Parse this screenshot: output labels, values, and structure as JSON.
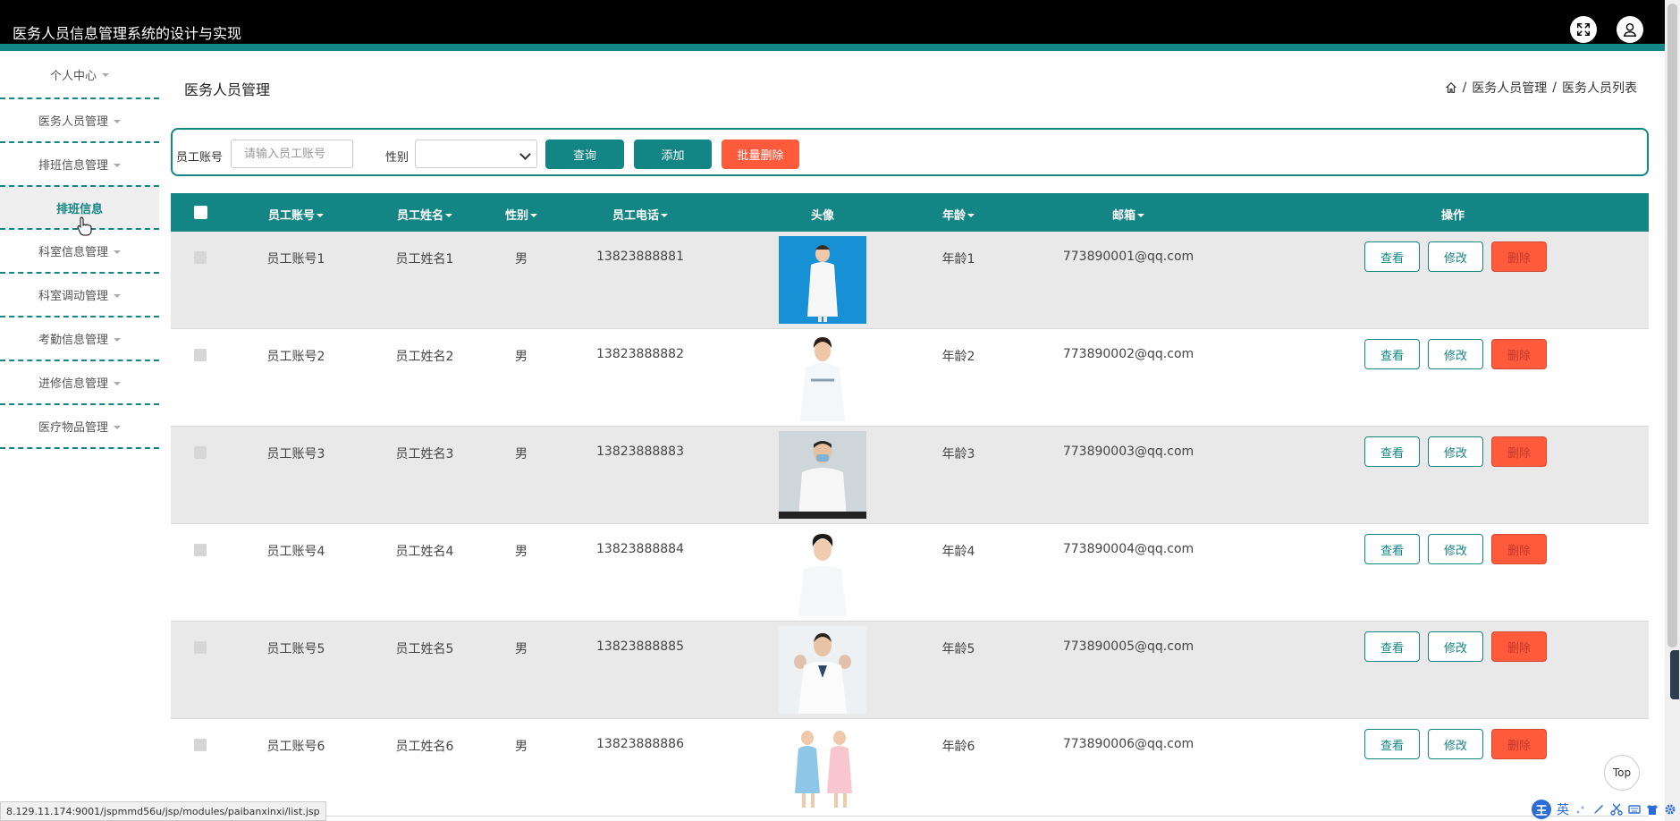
{
  "app": {
    "title": "医务人员信息管理系统的设计与实现"
  },
  "header_icons": [
    "fullscreen-icon",
    "user-icon"
  ],
  "sidebar": {
    "items": [
      {
        "label": "个人中心",
        "has_caret": true
      },
      {
        "label": "医务人员管理",
        "has_caret": true
      },
      {
        "label": "排班信息管理",
        "has_caret": true
      },
      {
        "label": "排班信息",
        "has_caret": false,
        "active": true
      },
      {
        "label": "科室信息管理",
        "has_caret": true
      },
      {
        "label": "科室调动管理",
        "has_caret": true
      },
      {
        "label": "考勤信息管理",
        "has_caret": true
      },
      {
        "label": "进修信息管理",
        "has_caret": true
      },
      {
        "label": "医疗物品管理",
        "has_caret": true
      }
    ]
  },
  "page": {
    "title": "医务人员管理",
    "breadcrumb": {
      "sep": "/",
      "level1": "医务人员管理",
      "level2": "医务人员列表"
    }
  },
  "search": {
    "account_label": "员工账号",
    "account_placeholder": "请输入员工账号",
    "gender_label": "性别",
    "gender_value": "",
    "query_button": "查询",
    "add_button": "添加",
    "batch_delete_button": "批量删除"
  },
  "table": {
    "columns": [
      "员工账号",
      "员工姓名",
      "性别",
      "员工电话",
      "头像",
      "年龄",
      "邮箱",
      "操作"
    ],
    "action_labels": {
      "view": "查看",
      "edit": "修改",
      "delete": "删除"
    },
    "rows": [
      {
        "account": "员工账号1",
        "name": "员工姓名1",
        "gender": "男",
        "phone": "13823888881",
        "age": "年龄1",
        "email": "773890001@qq.com"
      },
      {
        "account": "员工账号2",
        "name": "员工姓名2",
        "gender": "男",
        "phone": "13823888882",
        "age": "年龄2",
        "email": "773890002@qq.com"
      },
      {
        "account": "员工账号3",
        "name": "员工姓名3",
        "gender": "男",
        "phone": "13823888883",
        "age": "年龄3",
        "email": "773890003@qq.com"
      },
      {
        "account": "员工账号4",
        "name": "员工姓名4",
        "gender": "男",
        "phone": "13823888884",
        "age": "年龄4",
        "email": "773890004@qq.com"
      },
      {
        "account": "员工账号5",
        "name": "员工姓名5",
        "gender": "男",
        "phone": "13823888885",
        "age": "年龄5",
        "email": "773890005@qq.com"
      },
      {
        "account": "员工账号6",
        "name": "员工姓名6",
        "gender": "男",
        "phone": "13823888886",
        "age": "年龄6",
        "email": "773890006@qq.com"
      }
    ]
  },
  "status_url": "8.129.11.174:9001/jspmmd56u/jsp/modules/paibanxinxi/list.jsp",
  "top_button": "Top",
  "ime": {
    "badge": "王",
    "lang": "英"
  },
  "colors": {
    "primary": "#138584",
    "danger": "#ff5a3c",
    "header_bg": "#000000"
  }
}
